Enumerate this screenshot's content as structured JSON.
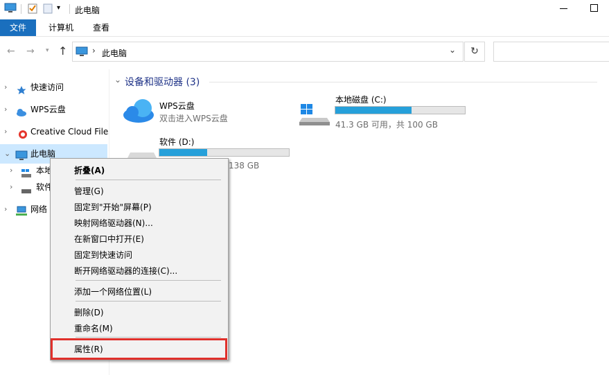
{
  "window": {
    "title": "此电脑"
  },
  "ribbon": {
    "tabs": [
      "文件",
      "计算机",
      "查看"
    ]
  },
  "address": {
    "location": "此电脑"
  },
  "nav_pane": {
    "items": [
      "快速访问",
      "WPS云盘",
      "Creative Cloud Files",
      "此电脑",
      "本地",
      "软件",
      "网络"
    ]
  },
  "content": {
    "group_title": "设备和驱动器 (3)",
    "drives": [
      {
        "name": "WPS云盘",
        "subtitle": "双击进入WPS云盘"
      },
      {
        "name": "本地磁盘 (C:)",
        "subtitle": "41.3 GB 可用，共 100 GB",
        "used_fraction": 0.587
      },
      {
        "name": "软件 (D:)",
        "subtitle": "138 GB",
        "used_fraction": 0.37
      }
    ]
  },
  "context_menu": {
    "items": {
      "collapse": "折叠(A)",
      "manage": "管理(G)",
      "pin_start": "固定到\"开始\"屏幕(P)",
      "map_drive": "映射网络驱动器(N)...",
      "open_new_window": "在新窗口中打开(E)",
      "pin_quick": "固定到快速访问",
      "disconnect": "断开网络驱动器的连接(C)...",
      "add_location": "添加一个网络位置(L)",
      "delete": "删除(D)",
      "rename": "重命名(M)",
      "properties": "属性(R)"
    }
  },
  "colors": {
    "accent": "#1a6fbe",
    "selection": "#cce8ff",
    "progress": "#26a0da",
    "highlight_box": "#e0302b"
  }
}
